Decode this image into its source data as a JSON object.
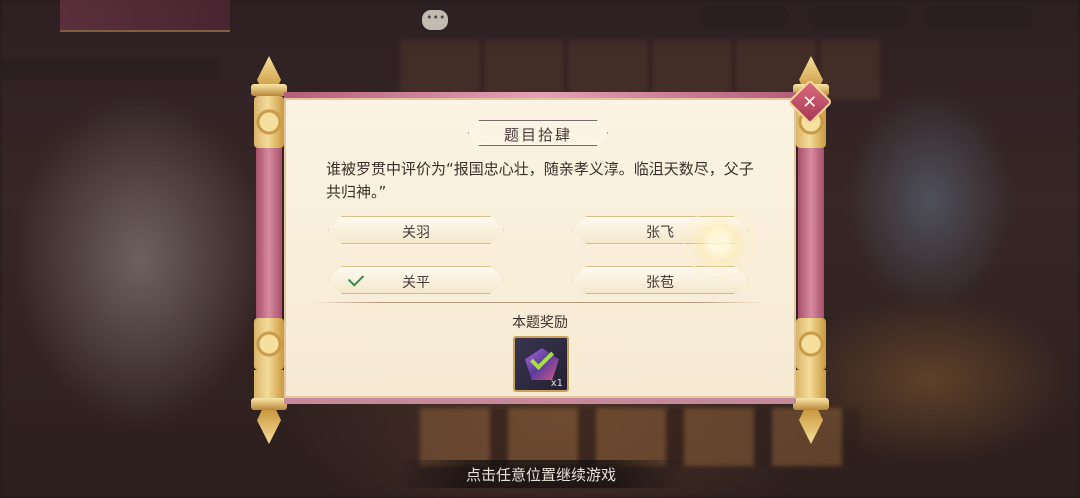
{
  "popup": {
    "title": "题目拾肆",
    "question": "谁被罗贯中评价为“报国忠心壮，随亲孝义淳。临沮天数尽，父子共归神。”",
    "options": [
      {
        "label": "关羽",
        "selected": false
      },
      {
        "label": "张飞",
        "selected": false
      },
      {
        "label": "关平",
        "selected": true
      },
      {
        "label": "张苞",
        "selected": false
      }
    ],
    "reward": {
      "title": "本题奖励",
      "count": "x1"
    },
    "close_icon": "✕"
  },
  "footer": {
    "continue_text": "点击任意位置继续游戏"
  },
  "colors": {
    "accent_pink": "#c48a9a",
    "gold": "#d9b46a",
    "parchment": "#f6ead2",
    "correct_green": "#3d8a4e"
  }
}
